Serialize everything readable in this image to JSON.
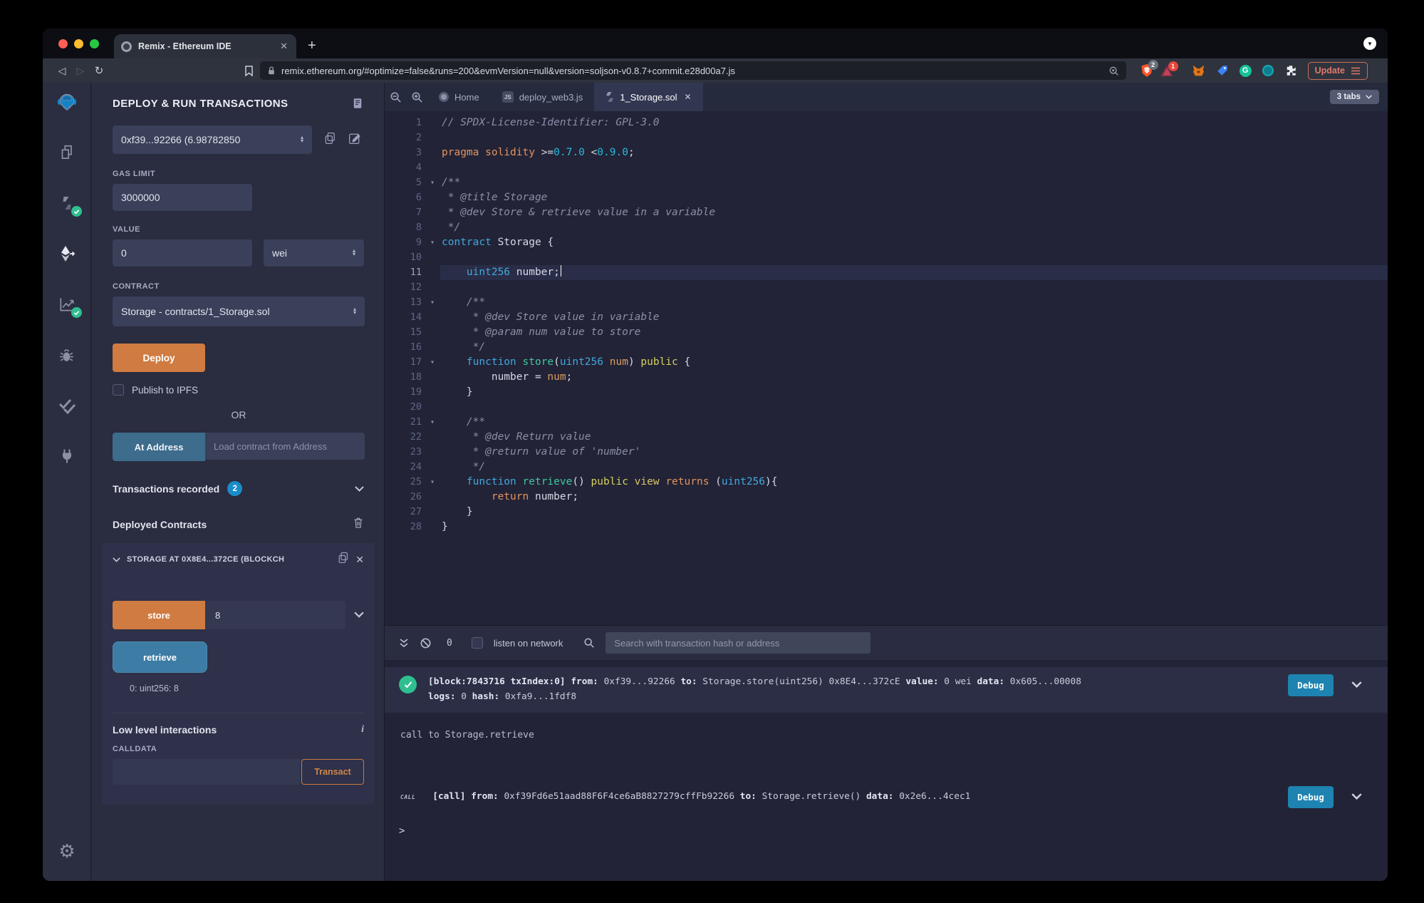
{
  "browser": {
    "tab_title": "Remix - Ethereum IDE",
    "close_tab": "✕",
    "new_tab": "+",
    "url": "remix.ethereum.org/#optimize=false&runs=200&evmVersion=null&version=soljson-v0.8.7+commit.e28d00a7.js",
    "shield_badge": "2",
    "ext_badge": "1",
    "grammarly_letter": "G",
    "update_label": "Update"
  },
  "rail": {
    "icons": [
      "remix-logo",
      "file-explorer",
      "solidity-compiler",
      "deploy-and-run",
      "solidity-analysis",
      "debugger",
      "unit-testing",
      "plugin-manager",
      "settings"
    ],
    "gear_glyph": "⚙"
  },
  "panel": {
    "title": "DEPLOY & RUN TRANSACTIONS",
    "account_value": "0xf39...92266 (6.98782850",
    "gas_label": "GAS LIMIT",
    "gas_value": "3000000",
    "value_label": "VALUE",
    "value_value": "0",
    "unit_value": "wei",
    "contract_label": "CONTRACT",
    "contract_value": "Storage - contracts/1_Storage.sol",
    "deploy_label": "Deploy",
    "publish_label": "Publish to IPFS",
    "or_label": "OR",
    "at_address_label": "At Address",
    "at_address_placeholder": "Load contract from Address",
    "transactions_label": "Transactions recorded",
    "transactions_count": "2",
    "deployed_label": "Deployed Contracts",
    "card": {
      "title": "STORAGE AT 0X8E4...372CE (BLOCKCH",
      "close": "✕",
      "store_label": "store",
      "store_value": "8",
      "retrieve_label": "retrieve",
      "result": "0: uint256: 8",
      "low_level_label": "Low level interactions",
      "info_glyph": "i",
      "calldata_label": "CALLDATA",
      "transact_label": "Transact"
    }
  },
  "editor": {
    "tabs": [
      {
        "label": "Home"
      },
      {
        "label": "deploy_web3.js"
      },
      {
        "label": "1_Storage.sol",
        "close": "✕"
      }
    ],
    "tabs_badge": "3 tabs",
    "js_badge": "JS",
    "lines": [
      {
        "n": 1,
        "seg": [
          [
            "c",
            "// SPDX-License-Identifier: GPL-3.0"
          ]
        ]
      },
      {
        "n": 2,
        "seg": []
      },
      {
        "n": 3,
        "seg": [
          [
            "k",
            "pragma solidity "
          ],
          [
            "w",
            ">="
          ],
          [
            "n",
            "0.7.0"
          ],
          [
            "w",
            " <"
          ],
          [
            "n",
            "0.9.0"
          ],
          [
            "w",
            ";"
          ]
        ]
      },
      {
        "n": 4,
        "seg": []
      },
      {
        "n": 5,
        "fold": true,
        "seg": [
          [
            "c",
            "/**"
          ]
        ]
      },
      {
        "n": 6,
        "seg": [
          [
            "c",
            " * @title Storage"
          ]
        ]
      },
      {
        "n": 7,
        "seg": [
          [
            "c",
            " * @dev Store & retrieve value in a variable"
          ]
        ]
      },
      {
        "n": 8,
        "seg": [
          [
            "c",
            " */"
          ]
        ]
      },
      {
        "n": 9,
        "fold": true,
        "seg": [
          [
            "t",
            "contract"
          ],
          [
            "w",
            " Storage {"
          ]
        ]
      },
      {
        "n": 10,
        "seg": []
      },
      {
        "n": 11,
        "active": true,
        "cursor": true,
        "seg": [
          [
            "w",
            "    "
          ],
          [
            "t",
            "uint256"
          ],
          [
            "w",
            " number;"
          ]
        ]
      },
      {
        "n": 12,
        "seg": []
      },
      {
        "n": 13,
        "fold": true,
        "seg": [
          [
            "c",
            "    /**"
          ]
        ]
      },
      {
        "n": 14,
        "seg": [
          [
            "c",
            "     * @dev Store value in variable"
          ]
        ]
      },
      {
        "n": 15,
        "seg": [
          [
            "c",
            "     * @param num value to store"
          ]
        ]
      },
      {
        "n": 16,
        "seg": [
          [
            "c",
            "     */"
          ]
        ]
      },
      {
        "n": 17,
        "fold": true,
        "seg": [
          [
            "w",
            "    "
          ],
          [
            "t",
            "function"
          ],
          [
            "w",
            " "
          ],
          [
            "f",
            "store"
          ],
          [
            "w",
            "("
          ],
          [
            "t",
            "uint256"
          ],
          [
            "w",
            " "
          ],
          [
            "p",
            "num"
          ],
          [
            "w",
            ") "
          ],
          [
            "m",
            "public"
          ],
          [
            "w",
            " {"
          ]
        ]
      },
      {
        "n": 18,
        "seg": [
          [
            "w",
            "        number = "
          ],
          [
            "p",
            "num"
          ],
          [
            "w",
            ";"
          ]
        ]
      },
      {
        "n": 19,
        "seg": [
          [
            "w",
            "    }"
          ]
        ]
      },
      {
        "n": 20,
        "seg": []
      },
      {
        "n": 21,
        "fold": true,
        "seg": [
          [
            "c",
            "    /**"
          ]
        ]
      },
      {
        "n": 22,
        "seg": [
          [
            "c",
            "     * @dev Return value"
          ]
        ]
      },
      {
        "n": 23,
        "seg": [
          [
            "c",
            "     * @return value of 'number'"
          ]
        ]
      },
      {
        "n": 24,
        "seg": [
          [
            "c",
            "     */"
          ]
        ]
      },
      {
        "n": 25,
        "fold": true,
        "seg": [
          [
            "w",
            "    "
          ],
          [
            "t",
            "function"
          ],
          [
            "w",
            " "
          ],
          [
            "f",
            "retrieve"
          ],
          [
            "w",
            "() "
          ],
          [
            "m",
            "public"
          ],
          [
            "w",
            " "
          ],
          [
            "g",
            "view"
          ],
          [
            "w",
            " "
          ],
          [
            "k",
            "returns"
          ],
          [
            "w",
            " ("
          ],
          [
            "t",
            "uint256"
          ],
          [
            "w",
            "){"
          ]
        ]
      },
      {
        "n": 26,
        "seg": [
          [
            "w",
            "        "
          ],
          [
            "k",
            "return"
          ],
          [
            "w",
            " number;"
          ]
        ]
      },
      {
        "n": 27,
        "seg": [
          [
            "w",
            "    }"
          ]
        ]
      },
      {
        "n": 28,
        "seg": [
          [
            "w",
            "}"
          ]
        ]
      }
    ]
  },
  "terminal": {
    "count": "0",
    "listen_label": "listen on network",
    "search_placeholder": "Search with transaction hash or address",
    "entries": [
      {
        "icon": "success",
        "rows": [
          [
            {
              "b": "[block:7843716 txIndex:0]"
            },
            {
              "v": " "
            },
            {
              "b": " from:"
            },
            {
              "v": " 0xf39...92266"
            },
            {
              "b": " to:"
            },
            {
              "v": " Storage.store(uint256) 0x8E4...372cE"
            },
            {
              "b": " value:"
            },
            {
              "v": " 0 wei"
            },
            {
              "b": " data:"
            },
            {
              "v": " 0x605...00008"
            }
          ],
          [
            {
              "b": "logs:"
            },
            {
              "v": " 0"
            },
            {
              "b": " hash:"
            },
            {
              "v": " 0xfa9...1fdf8"
            }
          ]
        ],
        "debug": "Debug"
      },
      {
        "icon": "call",
        "badge": "CALL",
        "rows": [
          [
            {
              "b": "[call]"
            },
            {
              "v": " "
            },
            {
              "b": " from:"
            },
            {
              "v": " 0xf39Fd6e51aad88F6F4ce6aB8827279cffFb92266"
            },
            {
              "b": " to:"
            },
            {
              "v": " Storage.retrieve()"
            },
            {
              "b": " data:"
            },
            {
              "v": " 0x2e6...4cec1"
            }
          ]
        ],
        "debug": "Debug"
      }
    ],
    "call_line": "call to Storage.retrieve",
    "prompt": ">"
  },
  "colors": {
    "accent_orange": "#d07b41",
    "accent_blue": "#1e83b0",
    "success_green": "#2fbe8f",
    "badge_blue": "#1a8cc9",
    "panel_bg": "#2a2c3f",
    "editor_bg": "#222336"
  }
}
